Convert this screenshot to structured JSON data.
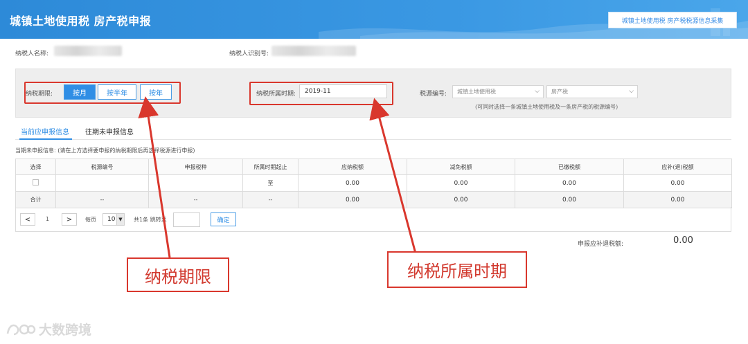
{
  "header": {
    "title": "城镇土地使用税 房产税申报",
    "collect_button": "城镇土地使用税 房产税税源信息采集"
  },
  "taxpayer": {
    "name_label": "纳税人名称:",
    "id_label": "纳税人识别号:"
  },
  "filter": {
    "period_label": "纳税期限:",
    "period_options": [
      "按月",
      "按半年",
      "按年"
    ],
    "period_selected": "按月",
    "belong_label": "纳税所属时期:",
    "belong_value": "2019-11",
    "source_label": "税源编号:",
    "source_select_1": "城镇土地使用税",
    "source_select_2": "房产税",
    "hint": "(可同时选择一条城镇土地使用税及一条房产税的税源编号)"
  },
  "tabs": [
    "当前应申报信息",
    "往期未申报信息"
  ],
  "notice": "当期未申报信息: (请在上方选择要申报的纳税期限后再选择税源进行申报)",
  "table": {
    "headers": [
      "选择",
      "税源编号",
      "申报税种",
      "所属时期起止",
      "应纳税额",
      "减免税额",
      "已缴税额",
      "应补(退)税额"
    ],
    "row": {
      "period": "至",
      "payable": "0.00",
      "relief": "0.00",
      "paid": "0.00",
      "refund": "0.00"
    },
    "total": {
      "label": "合计",
      "source": "--",
      "type": "--",
      "period": "--",
      "payable": "0.00",
      "relief": "0.00",
      "paid": "0.00",
      "refund": "0.00"
    }
  },
  "pager": {
    "prev": "<",
    "page": "1",
    "next": ">",
    "per_page_label": "每页",
    "page_size": "10",
    "summary": "共1条 跳转至",
    "confirm": "确定"
  },
  "refund": {
    "label": "申报应补退税额:",
    "value": "0.00"
  },
  "annotations": {
    "left_callout": "纳税期限",
    "right_callout": "纳税所属时期",
    "color": "#d9372d"
  },
  "watermark": "大数跨境"
}
